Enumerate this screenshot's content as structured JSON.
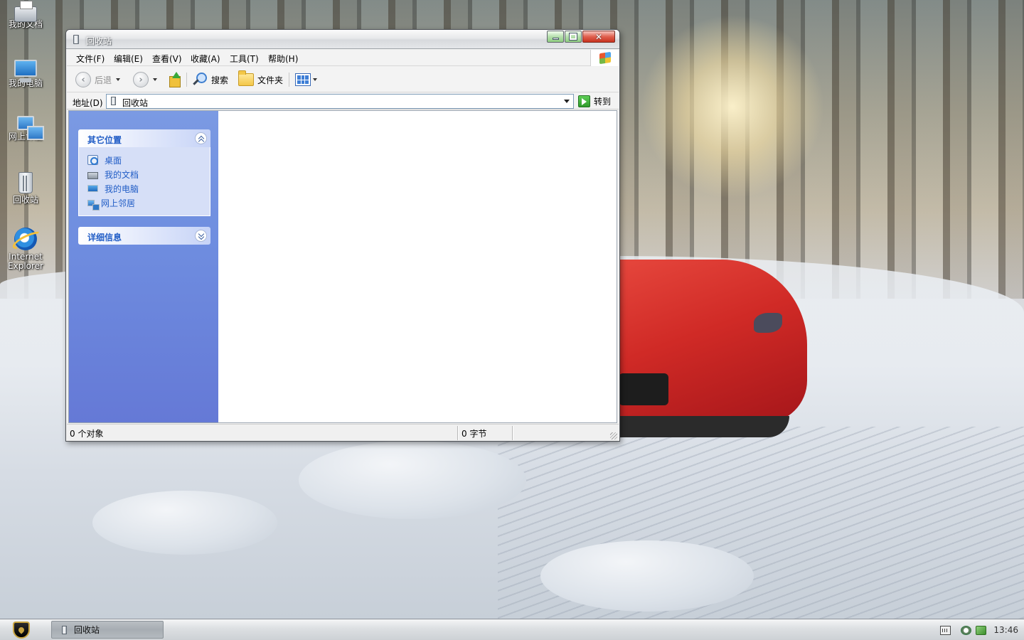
{
  "desktop": {
    "icons": [
      {
        "label": "我的文档",
        "icon": "printer-icon"
      },
      {
        "label": "我的电脑",
        "icon": "computer-icon"
      },
      {
        "label": "网上邻居",
        "icon": "network-icon"
      },
      {
        "label": "回收站",
        "icon": "recycle-bin-icon"
      },
      {
        "label_line1": "Internet",
        "label_line2": "Explorer",
        "icon": "ie-icon"
      }
    ]
  },
  "window": {
    "title": "回收站",
    "menu": [
      "文件(F)",
      "编辑(E)",
      "查看(V)",
      "收藏(A)",
      "工具(T)",
      "帮助(H)"
    ],
    "toolbar": {
      "back_label": "后退",
      "search_label": "搜索",
      "folders_label": "文件夹"
    },
    "address": {
      "label": "地址(D)",
      "value": "回收站",
      "go_label": "转到"
    },
    "taskpane": {
      "other_places": {
        "title": "其它位置",
        "items": [
          {
            "label": "桌面",
            "icon": "desktop-icon"
          },
          {
            "label": "我的文档",
            "icon": "my-documents-icon"
          },
          {
            "label": "我的电脑",
            "icon": "my-computer-icon"
          },
          {
            "label": "网上邻居",
            "icon": "network-places-icon"
          }
        ]
      },
      "details": {
        "title": "详细信息"
      }
    },
    "status": {
      "objects": "0 个对象",
      "size": "0 字节"
    }
  },
  "taskbar": {
    "task_label": "回收站",
    "clock": "13:46"
  },
  "colors": {
    "taskpane_blue": "#6f8ee0",
    "link_blue": "#215dc6",
    "close_red": "#c8321f"
  }
}
